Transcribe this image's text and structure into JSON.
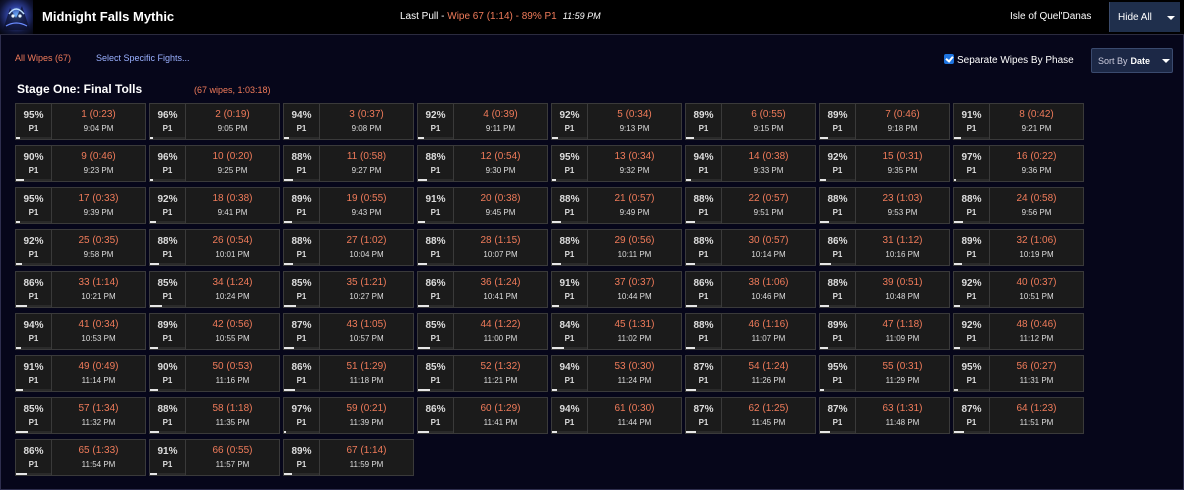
{
  "header": {
    "title": "Midnight Falls Mythic",
    "last_pull_prefix": "Last Pull - ",
    "last_pull_wipe": "Wipe 67 (1:14) - 89% P1",
    "last_pull_time": "11:59 PM",
    "zone": "Isle of Quel'Danas",
    "hide_all": "Hide All"
  },
  "filters": {
    "all_wipes": "All Wipes (67)",
    "select_fights": "Select Specific Fights...",
    "separate_wipes": "Separate Wipes By Phase",
    "sort_by_label": "Sort By",
    "sort_by_value": "Date"
  },
  "stage": {
    "title": "Stage One: Final Tolls",
    "meta": "(67 wipes, 1:03:18)"
  },
  "pulls": [
    {
      "pct": "95%",
      "phase": "P1",
      "label": "1 (0:23)",
      "time": "9:04 PM"
    },
    {
      "pct": "96%",
      "phase": "P1",
      "label": "2 (0:19)",
      "time": "9:05 PM"
    },
    {
      "pct": "94%",
      "phase": "P1",
      "label": "3 (0:37)",
      "time": "9:08 PM"
    },
    {
      "pct": "92%",
      "phase": "P1",
      "label": "4 (0:39)",
      "time": "9:11 PM"
    },
    {
      "pct": "92%",
      "phase": "P1",
      "label": "5 (0:34)",
      "time": "9:13 PM"
    },
    {
      "pct": "89%",
      "phase": "P1",
      "label": "6 (0:55)",
      "time": "9:15 PM"
    },
    {
      "pct": "89%",
      "phase": "P1",
      "label": "7 (0:46)",
      "time": "9:18 PM"
    },
    {
      "pct": "91%",
      "phase": "P1",
      "label": "8 (0:42)",
      "time": "9:21 PM"
    },
    {
      "pct": "90%",
      "phase": "P1",
      "label": "9 (0:46)",
      "time": "9:23 PM"
    },
    {
      "pct": "96%",
      "phase": "P1",
      "label": "10 (0:20)",
      "time": "9:25 PM"
    },
    {
      "pct": "88%",
      "phase": "P1",
      "label": "11 (0:58)",
      "time": "9:27 PM"
    },
    {
      "pct": "88%",
      "phase": "P1",
      "label": "12 (0:54)",
      "time": "9:30 PM"
    },
    {
      "pct": "95%",
      "phase": "P1",
      "label": "13 (0:34)",
      "time": "9:32 PM"
    },
    {
      "pct": "94%",
      "phase": "P1",
      "label": "14 (0:38)",
      "time": "9:33 PM"
    },
    {
      "pct": "92%",
      "phase": "P1",
      "label": "15 (0:31)",
      "time": "9:35 PM"
    },
    {
      "pct": "97%",
      "phase": "P1",
      "label": "16 (0:22)",
      "time": "9:36 PM"
    },
    {
      "pct": "95%",
      "phase": "P1",
      "label": "17 (0:33)",
      "time": "9:39 PM"
    },
    {
      "pct": "92%",
      "phase": "P1",
      "label": "18 (0:38)",
      "time": "9:41 PM"
    },
    {
      "pct": "89%",
      "phase": "P1",
      "label": "19 (0:55)",
      "time": "9:43 PM"
    },
    {
      "pct": "91%",
      "phase": "P1",
      "label": "20 (0:38)",
      "time": "9:45 PM"
    },
    {
      "pct": "88%",
      "phase": "P1",
      "label": "21 (0:57)",
      "time": "9:49 PM"
    },
    {
      "pct": "88%",
      "phase": "P1",
      "label": "22 (0:57)",
      "time": "9:51 PM"
    },
    {
      "pct": "88%",
      "phase": "P1",
      "label": "23 (1:03)",
      "time": "9:53 PM"
    },
    {
      "pct": "88%",
      "phase": "P1",
      "label": "24 (0:58)",
      "time": "9:56 PM"
    },
    {
      "pct": "92%",
      "phase": "P1",
      "label": "25 (0:35)",
      "time": "9:58 PM"
    },
    {
      "pct": "88%",
      "phase": "P1",
      "label": "26 (0:54)",
      "time": "10:01 PM"
    },
    {
      "pct": "88%",
      "phase": "P1",
      "label": "27 (1:02)",
      "time": "10:04 PM"
    },
    {
      "pct": "88%",
      "phase": "P1",
      "label": "28 (1:15)",
      "time": "10:07 PM"
    },
    {
      "pct": "88%",
      "phase": "P1",
      "label": "29 (0:56)",
      "time": "10:11 PM"
    },
    {
      "pct": "88%",
      "phase": "P1",
      "label": "30 (0:57)",
      "time": "10:14 PM"
    },
    {
      "pct": "86%",
      "phase": "P1",
      "label": "31 (1:12)",
      "time": "10:16 PM"
    },
    {
      "pct": "89%",
      "phase": "P1",
      "label": "32 (1:06)",
      "time": "10:19 PM"
    },
    {
      "pct": "86%",
      "phase": "P1",
      "label": "33 (1:14)",
      "time": "10:21 PM"
    },
    {
      "pct": "85%",
      "phase": "P1",
      "label": "34 (1:24)",
      "time": "10:24 PM"
    },
    {
      "pct": "85%",
      "phase": "P1",
      "label": "35 (1:21)",
      "time": "10:27 PM"
    },
    {
      "pct": "86%",
      "phase": "P1",
      "label": "36 (1:24)",
      "time": "10:41 PM"
    },
    {
      "pct": "91%",
      "phase": "P1",
      "label": "37 (0:37)",
      "time": "10:44 PM"
    },
    {
      "pct": "86%",
      "phase": "P1",
      "label": "38 (1:06)",
      "time": "10:46 PM"
    },
    {
      "pct": "88%",
      "phase": "P1",
      "label": "39 (0:51)",
      "time": "10:48 PM"
    },
    {
      "pct": "92%",
      "phase": "P1",
      "label": "40 (0:37)",
      "time": "10:51 PM"
    },
    {
      "pct": "94%",
      "phase": "P1",
      "label": "41 (0:34)",
      "time": "10:53 PM"
    },
    {
      "pct": "89%",
      "phase": "P1",
      "label": "42 (0:56)",
      "time": "10:55 PM"
    },
    {
      "pct": "87%",
      "phase": "P1",
      "label": "43 (1:05)",
      "time": "10:57 PM"
    },
    {
      "pct": "85%",
      "phase": "P1",
      "label": "44 (1:22)",
      "time": "11:00 PM"
    },
    {
      "pct": "84%",
      "phase": "P1",
      "label": "45 (1:31)",
      "time": "11:02 PM"
    },
    {
      "pct": "88%",
      "phase": "P1",
      "label": "46 (1:16)",
      "time": "11:07 PM"
    },
    {
      "pct": "89%",
      "phase": "P1",
      "label": "47 (1:18)",
      "time": "11:09 PM"
    },
    {
      "pct": "92%",
      "phase": "P1",
      "label": "48 (0:46)",
      "time": "11:12 PM"
    },
    {
      "pct": "91%",
      "phase": "P1",
      "label": "49 (0:49)",
      "time": "11:14 PM"
    },
    {
      "pct": "90%",
      "phase": "P1",
      "label": "50 (0:53)",
      "time": "11:16 PM"
    },
    {
      "pct": "86%",
      "phase": "P1",
      "label": "51 (1:29)",
      "time": "11:18 PM"
    },
    {
      "pct": "85%",
      "phase": "P1",
      "label": "52 (1:32)",
      "time": "11:21 PM"
    },
    {
      "pct": "94%",
      "phase": "P1",
      "label": "53 (0:30)",
      "time": "11:24 PM"
    },
    {
      "pct": "87%",
      "phase": "P1",
      "label": "54 (1:24)",
      "time": "11:26 PM"
    },
    {
      "pct": "95%",
      "phase": "P1",
      "label": "55 (0:31)",
      "time": "11:29 PM"
    },
    {
      "pct": "95%",
      "phase": "P1",
      "label": "56 (0:27)",
      "time": "11:31 PM"
    },
    {
      "pct": "85%",
      "phase": "P1",
      "label": "57 (1:34)",
      "time": "11:32 PM"
    },
    {
      "pct": "88%",
      "phase": "P1",
      "label": "58 (1:18)",
      "time": "11:35 PM"
    },
    {
      "pct": "97%",
      "phase": "P1",
      "label": "59 (0:21)",
      "time": "11:39 PM"
    },
    {
      "pct": "86%",
      "phase": "P1",
      "label": "60 (1:29)",
      "time": "11:41 PM"
    },
    {
      "pct": "94%",
      "phase": "P1",
      "label": "61 (0:30)",
      "time": "11:44 PM"
    },
    {
      "pct": "87%",
      "phase": "P1",
      "label": "62 (1:25)",
      "time": "11:45 PM"
    },
    {
      "pct": "87%",
      "phase": "P1",
      "label": "63 (1:31)",
      "time": "11:48 PM"
    },
    {
      "pct": "87%",
      "phase": "P1",
      "label": "64 (1:23)",
      "time": "11:51 PM"
    },
    {
      "pct": "86%",
      "phase": "P1",
      "label": "65 (1:33)",
      "time": "11:54 PM"
    },
    {
      "pct": "91%",
      "phase": "P1",
      "label": "66 (0:55)",
      "time": "11:57 PM"
    },
    {
      "pct": "89%",
      "phase": "P1",
      "label": "67 (1:14)",
      "time": "11:59 PM"
    }
  ],
  "colors": {
    "accent_orange": "#f07b5a",
    "link_blue": "#9ab0ff",
    "checkbox_blue": "#1e74e0",
    "background": "#06061a"
  },
  "icons": {
    "boss": "boss-portrait-icon",
    "hide_all_caret": "chevron-down-icon",
    "sort_caret": "chevron-down-icon",
    "separate_checkbox": "checkbox-checked-icon"
  }
}
